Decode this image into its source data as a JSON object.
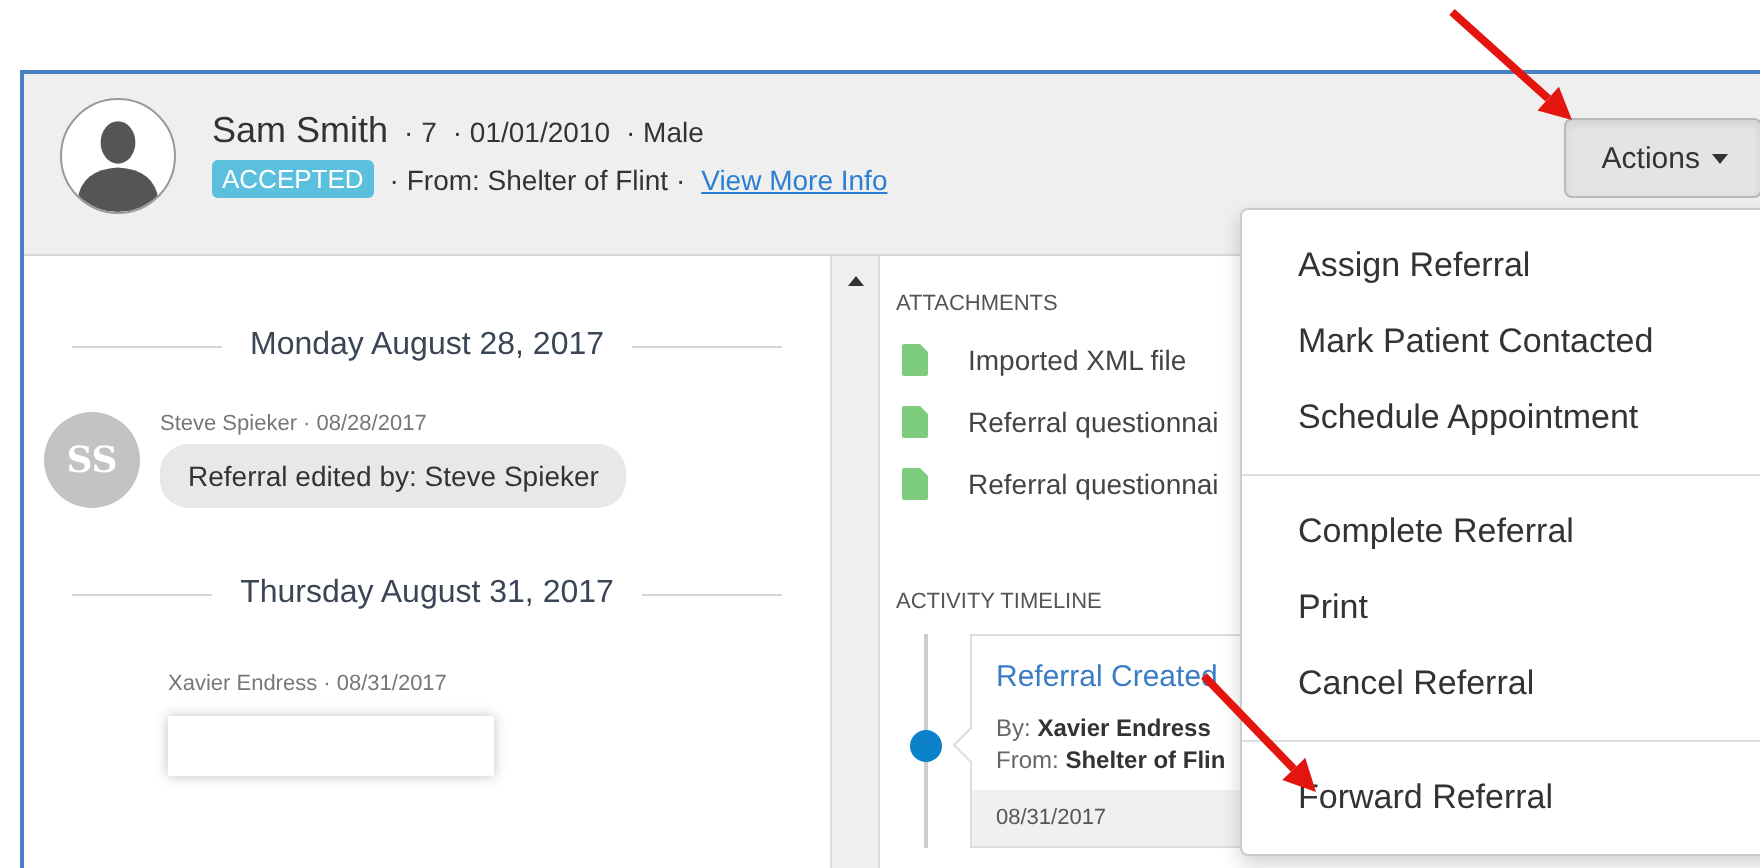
{
  "patient": {
    "name": "Sam Smith",
    "meta": [
      "· 7",
      "· 01/01/2010",
      "· Male"
    ],
    "status": "ACCEPTED",
    "from": "· From: Shelter of Flint ·",
    "link": "View More Info"
  },
  "actions_button": {
    "label": "Actions",
    "expanded": true
  },
  "conversation": [
    {
      "kind": "date",
      "text": "Monday August 28, 2017"
    },
    {
      "kind": "message",
      "initials": "SS",
      "meta": "Steve Spieker · 08/28/2017",
      "text": "Referral edited by: Steve Spieker"
    },
    {
      "kind": "date",
      "text": "Thursday August 31, 2017"
    },
    {
      "kind": "message",
      "meta": "Xavier Endress · 08/31/2017"
    }
  ],
  "attachments": {
    "title": "ATTACHMENTS",
    "items": [
      "Imported XML file",
      "Referral questionnai",
      "Referral questionnai"
    ]
  },
  "activity_timeline": {
    "title": "ACTIVITY TIMELINE",
    "entries": [
      {
        "title": "Referral Created",
        "by_label": "By:",
        "by": "Xavier Endress",
        "from_label": "From:",
        "from": "Shelter of Flin",
        "date": "08/31/2017"
      }
    ]
  },
  "actions_menu": {
    "groups": [
      [
        "Assign Referral",
        "Mark Patient Contacted",
        "Schedule Appointment"
      ],
      [
        "Complete Referral",
        "Print",
        "Cancel Referral"
      ],
      [
        "Forward Referral"
      ]
    ]
  }
}
